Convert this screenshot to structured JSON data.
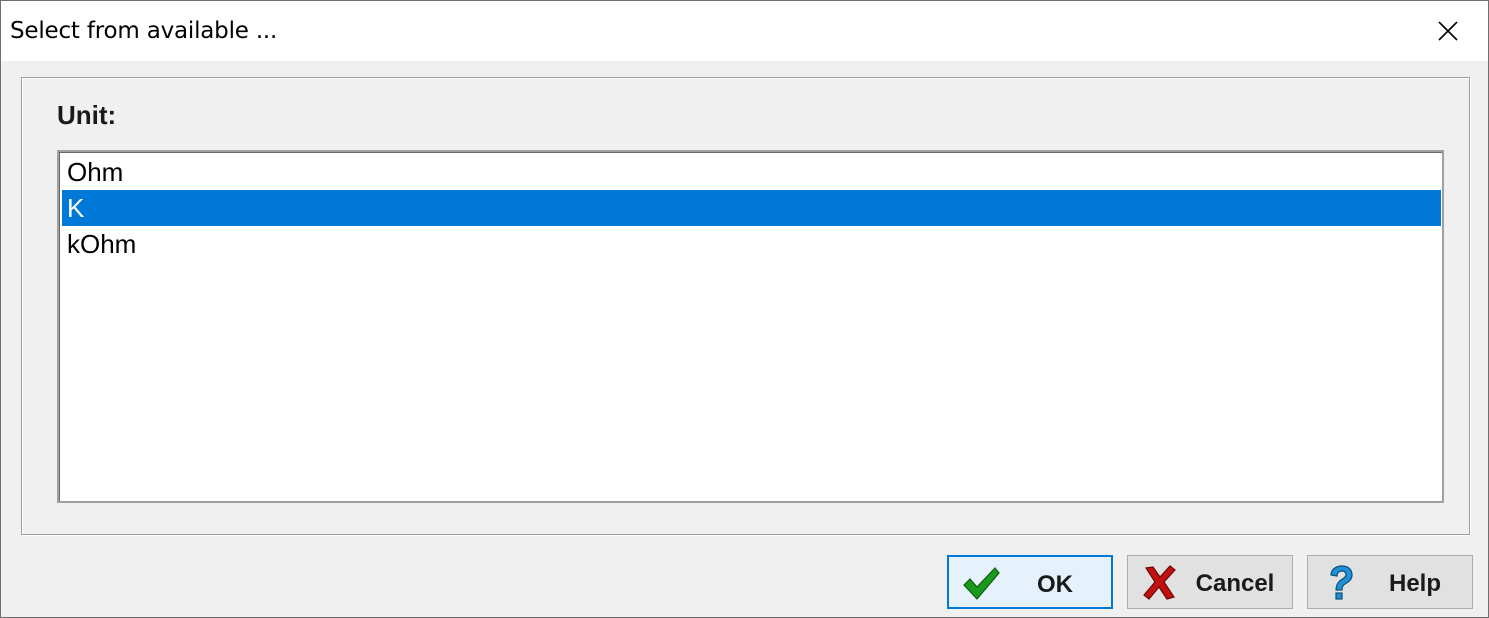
{
  "window": {
    "title": "Select from available ..."
  },
  "panel": {
    "label": "Unit:"
  },
  "list": {
    "items": [
      {
        "label": " Ohm",
        "selected": false
      },
      {
        "label": "K",
        "selected": true
      },
      {
        "label": "kOhm",
        "selected": false
      }
    ]
  },
  "buttons": {
    "ok_label": "OK",
    "cancel_label": "Cancel",
    "help_label": "Help"
  },
  "colors": {
    "selection": "#0078d7",
    "ok_icon": "#1a9a1a",
    "cancel_icon": "#c21010",
    "help_icon": "#1e90d6"
  },
  "icons": {
    "close": "close-icon",
    "ok": "checkmark-icon",
    "cancel": "red-x-icon",
    "help": "question-mark-icon"
  }
}
